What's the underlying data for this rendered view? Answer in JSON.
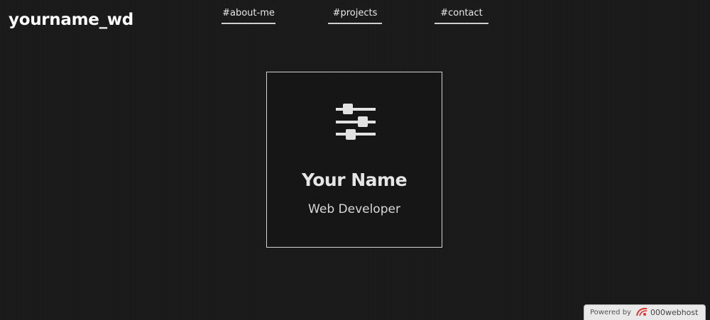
{
  "header": {
    "logo_text": "yourname_wd"
  },
  "nav": {
    "items": [
      {
        "label": "#about-me"
      },
      {
        "label": "#projects"
      },
      {
        "label": "#contact"
      }
    ]
  },
  "card": {
    "icon": "sliders-icon",
    "name": "Your Name",
    "role": "Web Developer"
  },
  "footer_badge": {
    "powered_label": "Powered by",
    "host_icon": "000webhost-logo-icon",
    "host_name": "000webhost"
  },
  "colors": {
    "background": "#1a1a1a",
    "text": "#ffffff",
    "card_border": "#d4d4d4",
    "badge_background": "#e9e9e9",
    "host_logo": "#e0322a"
  }
}
